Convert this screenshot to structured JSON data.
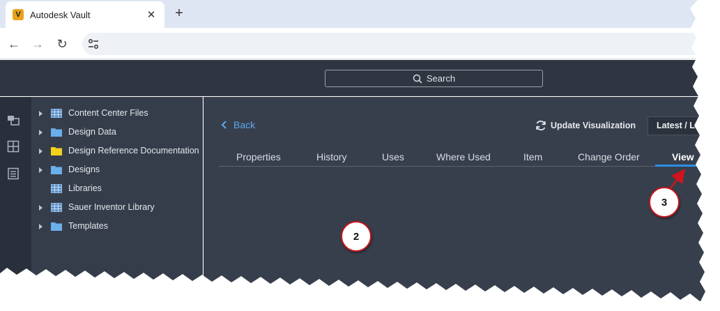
{
  "browser": {
    "tab_title": "Autodesk Vault",
    "favicon_letter": "V",
    "close_glyph": "✕",
    "new_tab_glyph": "+",
    "back_glyph": "←",
    "forward_glyph": "→",
    "reload_glyph": "↻"
  },
  "header": {
    "search_placeholder": "Search"
  },
  "tree": {
    "items": [
      {
        "label": "Content Center Files",
        "icon": "library-grid-icon",
        "expandable": true
      },
      {
        "label": "Design Data",
        "icon": "folder-icon",
        "expandable": true
      },
      {
        "label": "Design Reference Documentation",
        "icon": "folder-yellow-icon",
        "expandable": true
      },
      {
        "label": "Designs",
        "icon": "folder-icon",
        "expandable": true
      },
      {
        "label": "Libraries",
        "icon": "library-grid-icon",
        "expandable": false
      },
      {
        "label": "Sauer Inventor Library",
        "icon": "library-grid-icon",
        "expandable": true
      },
      {
        "label": "Templates",
        "icon": "folder-icon",
        "expandable": true
      }
    ]
  },
  "main": {
    "back_label": "Back",
    "update_viz_label": "Update Visualization",
    "version_label": "Latest / Lat",
    "tabs": [
      {
        "label": "Properties"
      },
      {
        "label": "History"
      },
      {
        "label": "Uses"
      },
      {
        "label": "Where Used"
      },
      {
        "label": "Item"
      },
      {
        "label": "Change Order"
      },
      {
        "label": "View",
        "active": true
      }
    ]
  },
  "annotations": {
    "callout_2": "2",
    "callout_3": "3"
  },
  "colors": {
    "accent": "#2e8fe6",
    "link": "#5aa9f0",
    "callout_border": "#c8161d",
    "folder_blue": "#6aaeea",
    "folder_yellow": "#f2d21b"
  }
}
